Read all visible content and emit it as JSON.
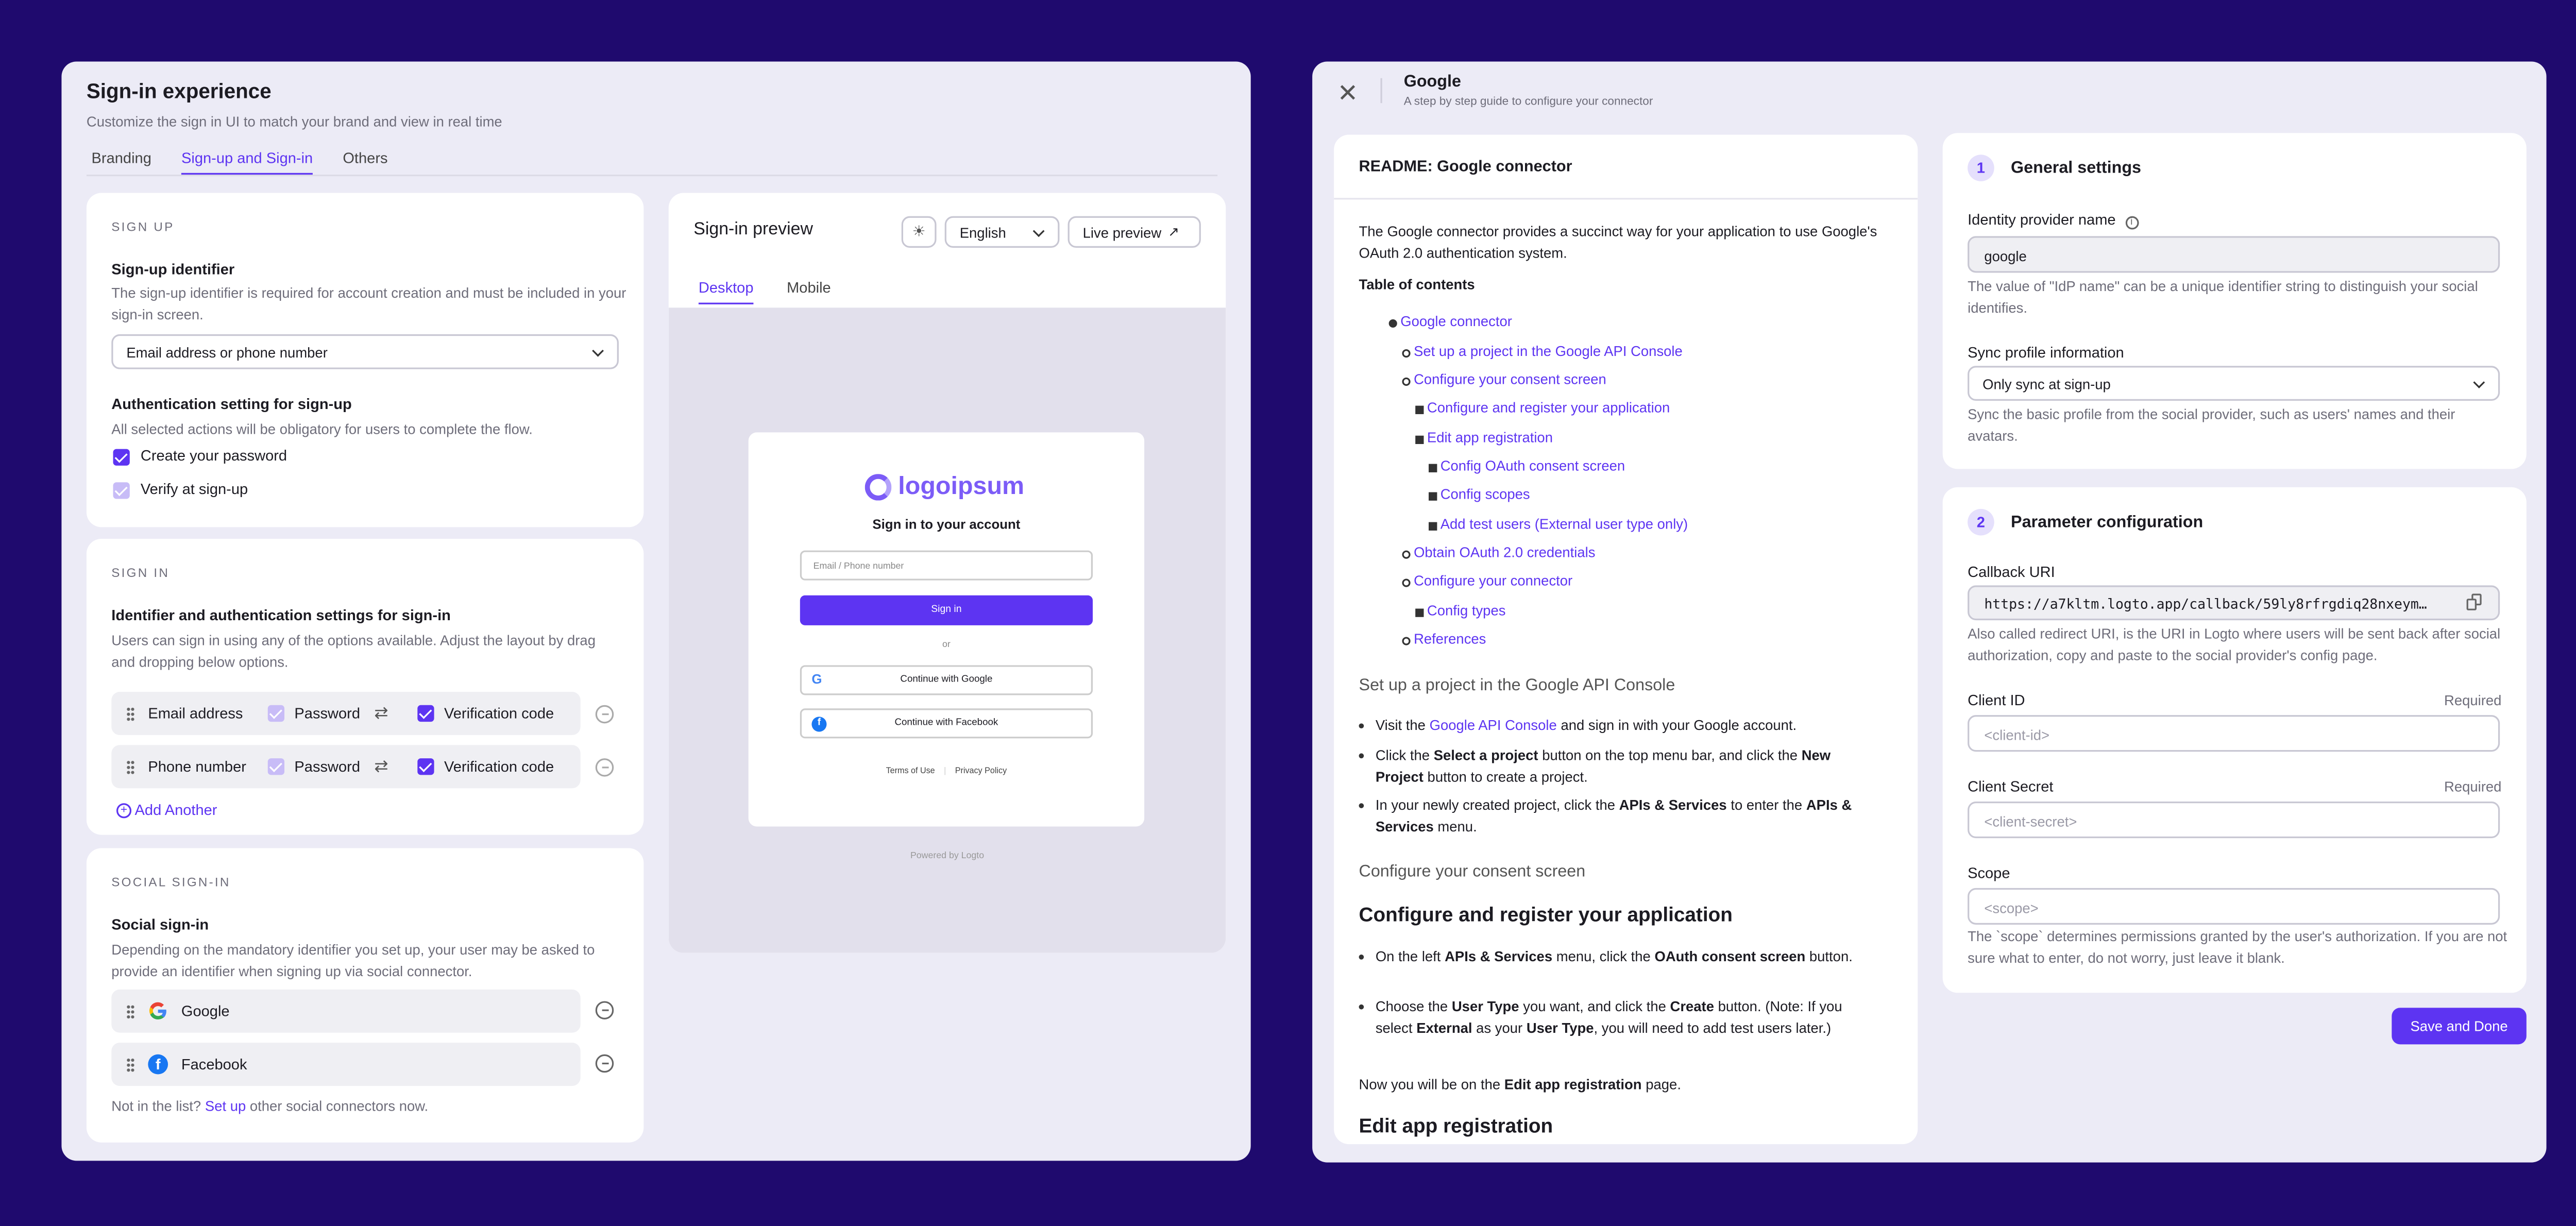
{
  "left": {
    "title": "Sign-in experience",
    "subtitle": "Customize the sign in UI to match your brand and view in real time",
    "tabs": [
      "Branding",
      "Sign-up and Sign-in",
      "Others"
    ],
    "signup": {
      "section": "SIGN UP",
      "identifier_label": "Sign-up identifier",
      "identifier_desc": "The sign-up identifier is required for account creation and must be included in your sign-in screen.",
      "identifier_value": "Email address or phone number",
      "auth_label": "Authentication setting for sign-up",
      "auth_desc": "All selected actions will be obligatory for users to complete the flow.",
      "opt1": "Create your password",
      "opt2": "Verify at sign-up"
    },
    "signin": {
      "section": "SIGN IN",
      "label": "Identifier and authentication settings for sign-in",
      "desc": "Users can sign in using any of the options available. Adjust the layout by drag and dropping below options.",
      "rows": [
        {
          "identifier": "Email address",
          "password": "Password",
          "code": "Verification code"
        },
        {
          "identifier": "Phone number",
          "password": "Password",
          "code": "Verification code"
        }
      ],
      "add": "Add Another"
    },
    "social": {
      "section": "SOCIAL SIGN-IN",
      "label": "Social sign-in",
      "desc": "Depending on the mandatory identifier you set up, your user may be asked to provide an identifier when signing up via social connector.",
      "items": [
        "Google",
        "Facebook"
      ],
      "footer_pre": "Not in the list?",
      "footer_link": "Set up",
      "footer_post": "other social connectors now."
    },
    "preview": {
      "title": "Sign-in preview",
      "language": "English",
      "live": "Live preview",
      "tabs": [
        "Desktop",
        "Mobile"
      ],
      "logo": "logoipsum",
      "heading": "Sign in to your account",
      "placeholder": "Email / Phone number",
      "signin": "Sign in",
      "or": "or",
      "google": "Continue with Google",
      "facebook": "Continue with Facebook",
      "terms": "Terms of Use",
      "privacy": "Privacy Policy",
      "powered": "Powered by",
      "brand": "Logto"
    }
  },
  "right": {
    "title": "Google",
    "subtitle": "A step by step guide to configure your connector",
    "readme": {
      "title": "README: Google connector",
      "intro": "The Google connector provides a succinct way for your application to use Google's OAuth 2.0 authentication system.",
      "toc_title": "Table of contents",
      "toc": [
        "Google connector",
        "Set up a project in the Google API Console",
        "Configure your consent screen",
        "Configure and register your application",
        "Edit app registration",
        "Config OAuth consent screen",
        "Config scopes",
        "Add test users (External user type only)",
        "Obtain OAuth 2.0 credentials",
        "Configure your connector",
        "Config types",
        "References"
      ],
      "h_setup": "Set up a project in the Google API Console",
      "b1_pre": "Visit the",
      "b1_link": "Google API Console",
      "b1_post": "and sign in with your Google account.",
      "b2_a": "Click the",
      "b2_b": "Select a project",
      "b2_c": "button on the top menu bar, and click the",
      "b2_d": "New Project",
      "b2_e": "button to create a project.",
      "b3_a": "In your newly created project, click the",
      "b3_b": "APIs & Services",
      "b3_c": "to enter the",
      "b3_d": "APIs & Services",
      "b3_e": "menu.",
      "h_consent": "Configure your consent screen",
      "h_register": "Configure and register your application",
      "b4_a": "On the left",
      "b4_b": "APIs & Services",
      "b4_c": "menu, click the",
      "b4_d": "OAuth consent screen",
      "b4_e": "button.",
      "b5_a": "Choose the",
      "b5_b": "User Type",
      "b5_c": "you want, and click the",
      "b5_d": "Create",
      "b5_e": "button. (Note: If you select",
      "b5_f": "External",
      "b5_g": "as your",
      "b5_h": "User Type",
      "b5_i": ", you will need to add test users later.)",
      "p_a": "Now you will be on the",
      "p_b": "Edit app registration",
      "p_c": "page.",
      "h_edit": "Edit app registration"
    },
    "general": {
      "num": "1",
      "title": "General settings",
      "idp_label": "Identity provider name",
      "idp_value": "google",
      "idp_desc": "The value of \"IdP name\" can be a unique identifier string to distinguish your social identifies.",
      "sync_label": "Sync profile information",
      "sync_value": "Only sync at sign-up",
      "sync_desc": "Sync the basic profile from the social provider, such as users' names and their avatars."
    },
    "params": {
      "num": "2",
      "title": "Parameter configuration",
      "callback_label": "Callback URI",
      "callback_value": "https://a7kltm.logto.app/callback/59ly8rfrgdiq28nxeym…",
      "callback_desc": "Also called redirect URI, is the URI in Logto where users will be sent back after social authorization, copy and paste to the social provider's config page.",
      "client_id_label": "Client ID",
      "client_id_ph": "<client-id>",
      "client_secret_label": "Client Secret",
      "client_secret_ph": "<client-secret>",
      "required": "Required",
      "scope_label": "Scope",
      "scope_ph": "<scope>",
      "scope_desc": "The `scope` determines permissions granted by the user's authorization. If you are not sure what to enter, do not worry, just leave it blank."
    },
    "save": "Save and Done"
  },
  "colors": {
    "accent": "#5d34f2",
    "background": "#1f0a6e",
    "panel": "#ecebf6"
  }
}
